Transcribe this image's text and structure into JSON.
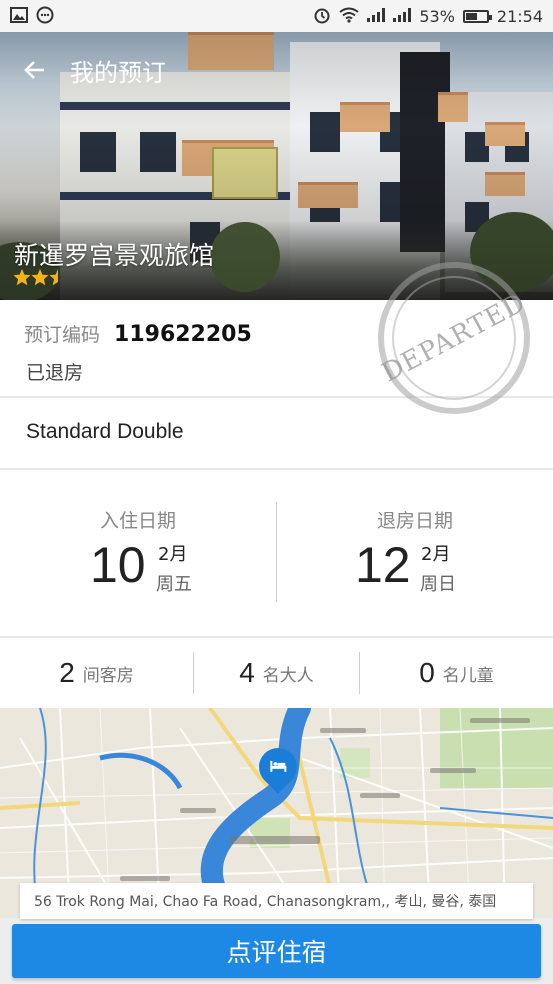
{
  "status_bar": {
    "left_icons": [
      "image-icon",
      "chat-icon"
    ],
    "battery_percent": "53%",
    "battery_level": 0.53,
    "time": "21:54"
  },
  "header": {
    "title": "我的预订"
  },
  "hotel": {
    "name": "新暹罗宫景观旅馆",
    "star_rating": 2.5,
    "stars_display": "★★⯪"
  },
  "stamp_text": "DEPARTED",
  "booking": {
    "label": "预订编码",
    "number": "119622205",
    "status": "已退房"
  },
  "room": {
    "type": "Standard Double"
  },
  "checkin": {
    "label": "入住日期",
    "day": "10",
    "month": "2月",
    "weekday": "周五"
  },
  "checkout": {
    "label": "退房日期",
    "day": "12",
    "month": "2月",
    "weekday": "周日"
  },
  "guests": {
    "rooms_num": "2",
    "rooms_label": "间客房",
    "adults_num": "4",
    "adults_label": "名大人",
    "children_num": "0",
    "children_label": "名儿童"
  },
  "map": {
    "address": "56 Trok Rong Mai, Chao Fa Road, Chanasongkram,, 考山, 曼谷, 泰国"
  },
  "actions": {
    "review_label": "点评住宿"
  },
  "colors": {
    "accent": "#1e88e5",
    "star": "#f2b21b",
    "river": "#3a87d9"
  }
}
